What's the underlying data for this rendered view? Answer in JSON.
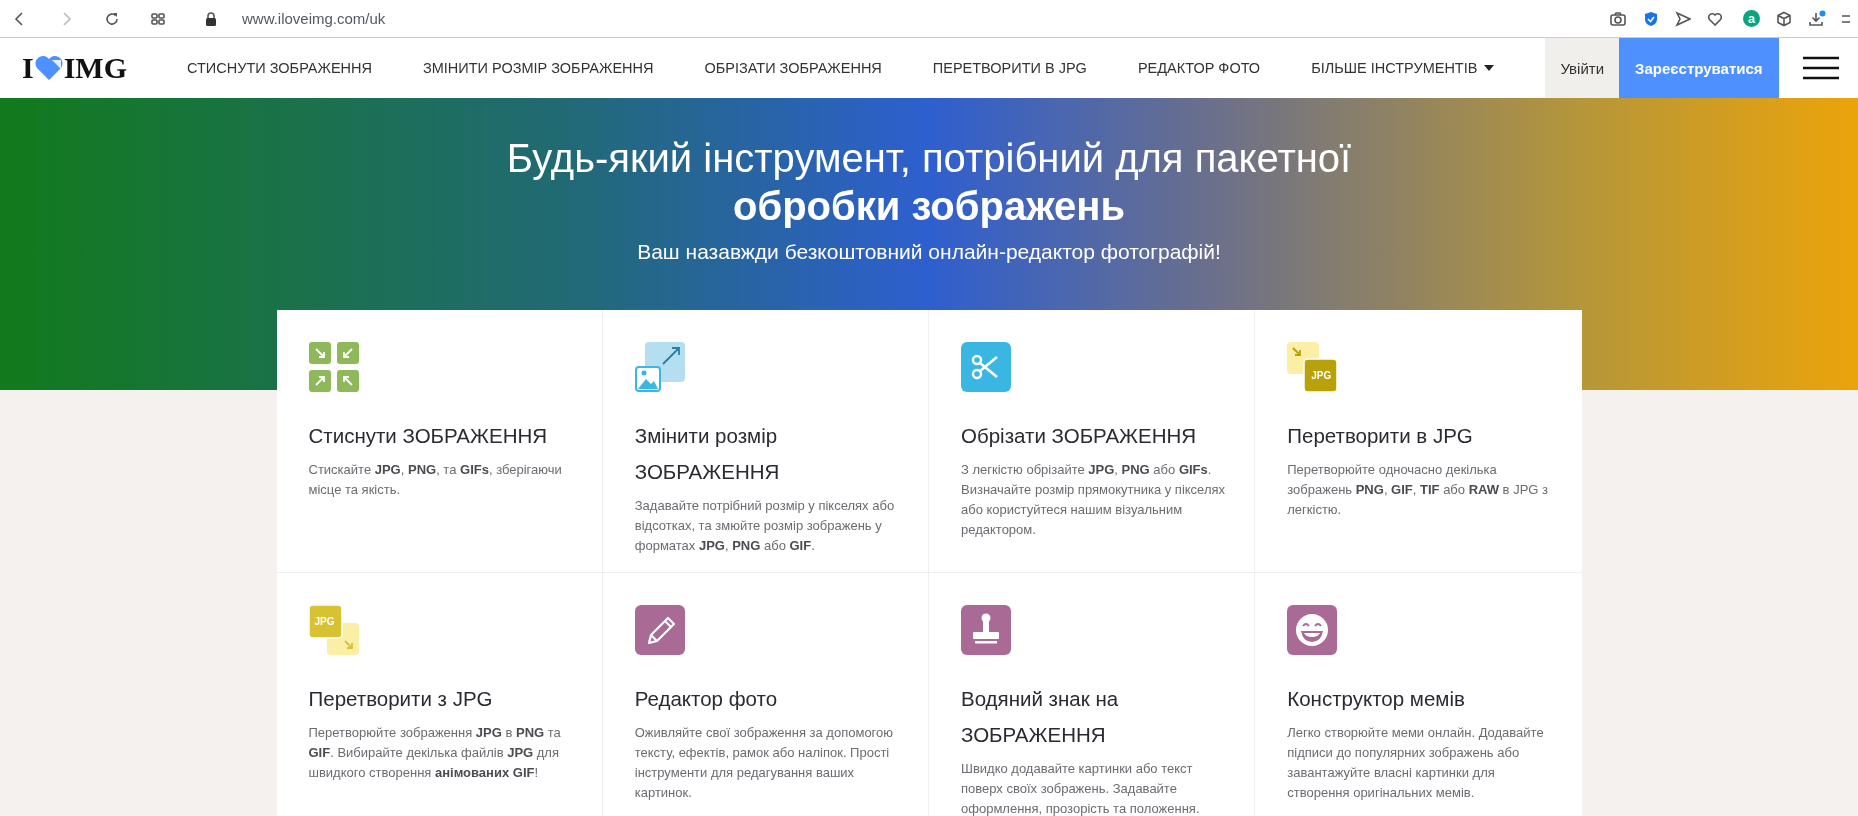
{
  "browser": {
    "forward_disabled": true,
    "url": "www.iloveimg.com/uk",
    "extension_letter": "a",
    "download_badge": true
  },
  "logo": {
    "left": "I",
    "right": "IMG"
  },
  "nav": {
    "items": [
      {
        "label": "СТИСНУТИ ЗОБРАЖЕННЯ",
        "dropdown": false
      },
      {
        "label": "ЗМІНИТИ РОЗМІР ЗОБРАЖЕННЯ",
        "dropdown": false
      },
      {
        "label": "ОБРІЗАТИ ЗОБРАЖЕННЯ",
        "dropdown": false
      },
      {
        "label": "ПЕРЕТВОРИТИ В JPG",
        "dropdown": false
      },
      {
        "label": "РЕДАКТОР ФОТО",
        "dropdown": false
      },
      {
        "label": "БІЛЬШЕ ІНСТРУМЕНТІВ",
        "dropdown": true
      }
    ],
    "login": "Увійти",
    "signup": "Зареєструватися"
  },
  "hero": {
    "title": "Будь-який інструмент, потрібний для пакетної **обробки зображень**",
    "subtitle": "Ваш назавжди безкоштовний онлайн-редактор фотографій!"
  },
  "tools": [
    {
      "kind": "compress",
      "title": "Стиснути ЗОБРАЖЕННЯ",
      "description": "Стискайте **JPG**, **PNG**, та **GIFs**, зберігаючи місце та якість."
    },
    {
      "kind": "resize",
      "title": "Змінити розмір ЗОБРАЖЕННЯ",
      "description": "Задавайте потрібний розмір у пікселях або відсотках, та змюйте розмір зображень у форматах **JPG**, **PNG** або **GIF**."
    },
    {
      "kind": "crop",
      "title": "Обрізати ЗОБРАЖЕННЯ",
      "description": "З легкістю обрізайте **JPG**, **PNG** або **GIFs**. Визначайте розмір прямокутника у пікселях або користуйтеся нашим візуальним редактором."
    },
    {
      "kind": "to-jpg",
      "icon_label": "JPG",
      "title": "Перетворити в JPG",
      "description": "Перетворюйте одночасно декілька зображень **PNG**, **GIF**, **TIF** або **RAW** в JPG з легкістю."
    },
    {
      "kind": "from-jpg",
      "icon_label": "JPG",
      "title": "Перетворити з JPG",
      "description": "Перетворюйте зображення **JPG** в **PNG** та **GIF**. Вибирайте декілька файлів **JPG** для швидкого створення **анімованих GIF**!"
    },
    {
      "kind": "edit",
      "title": "Редактор фото",
      "description": "Оживляйте свої зображення за допомогою тексту, ефектів, рамок або наліпок. Прості інструменти для редагування ваших картинок."
    },
    {
      "kind": "watermark",
      "title": "Водяний знак на ЗОБРАЖЕННЯ",
      "description": "Швидко додавайте картинки або текст поверх своїх зображень. Задавайте оформлення, прозорість та положення."
    },
    {
      "kind": "meme",
      "title": "Конструктор мемів",
      "description": "Легко створюйте меми онлайн. Додавайте підписи до популярних зображень або завантажуйте власні картинки для створення оригінальних мемів."
    }
  ]
}
